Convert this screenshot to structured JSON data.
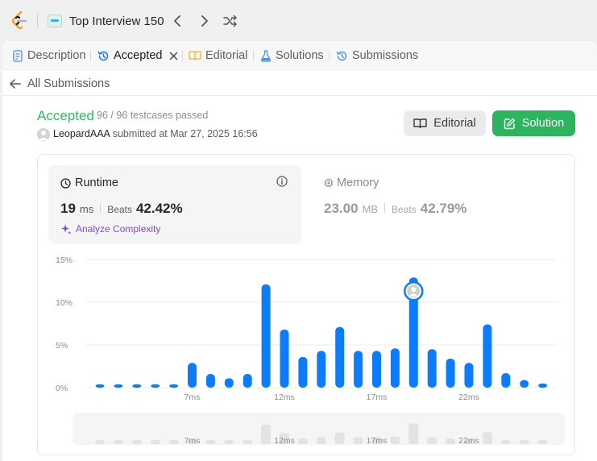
{
  "topbar": {
    "list_title": "Top Interview 150",
    "icons": [
      "leetcode-logo",
      "chevron-left-icon",
      "chevron-right-icon",
      "shuffle-icon"
    ]
  },
  "tabs": [
    {
      "label": "Description",
      "icon": "description-icon"
    },
    {
      "label": "Accepted",
      "icon": "history-icon",
      "active": true
    },
    {
      "label": "Editorial",
      "icon": "book-icon"
    },
    {
      "label": "Solutions",
      "icon": "flask-icon"
    },
    {
      "label": "Submissions",
      "icon": "history-icon"
    }
  ],
  "back_link": "All Submissions",
  "submission": {
    "status": "Accepted",
    "testcases": "96 / 96 testcases passed",
    "user": "LeopardAAA",
    "submitted_text": "submitted at Mar 27, 2025 16:56"
  },
  "buttons": {
    "editorial": "Editorial",
    "solution": "Solution"
  },
  "runtime": {
    "title": "Runtime",
    "value": "19",
    "unit": "ms",
    "beats_label": "Beats",
    "beats": "42.42%",
    "analyze": "Analyze Complexity"
  },
  "memory": {
    "title": "Memory",
    "value": "23.00",
    "unit": "MB",
    "beats_label": "Beats",
    "beats": "42.79%"
  },
  "colors": {
    "accent_green": "#2cbb5d",
    "bar_blue": "#0a7cff",
    "muted_bar": "#e3e3e3"
  },
  "chart_data": {
    "type": "bar",
    "ylim": [
      0,
      15
    ],
    "yticks": [
      "0%",
      "5%",
      "10%",
      "15%"
    ],
    "xticks": [
      "7ms",
      "12ms",
      "17ms",
      "22ms"
    ],
    "xtick_bins": [
      5,
      10,
      15,
      20
    ],
    "values": [
      0.4,
      0.4,
      0.4,
      0.4,
      0.4,
      2.9,
      1.6,
      1.1,
      1.6,
      12.1,
      6.8,
      3.6,
      4.3,
      7.1,
      4.3,
      4.3,
      4.6,
      12.9,
      4.5,
      3.4,
      2.9,
      7.4,
      1.7,
      0.9,
      0.5
    ],
    "highlight_index": 17,
    "grid": true
  }
}
